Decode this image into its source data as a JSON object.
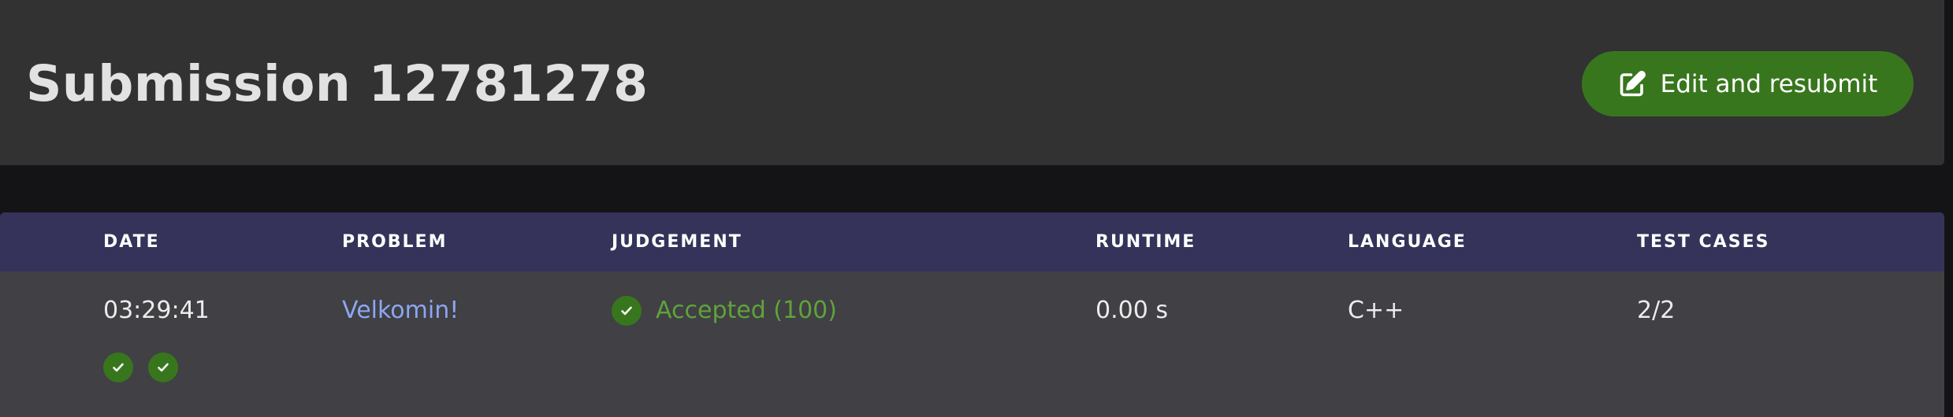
{
  "header": {
    "title": "Submission 12781278",
    "resubmit_label": "Edit and resubmit",
    "resubmit_icon": "edit-icon"
  },
  "table": {
    "columns": [
      "DATE",
      "PROBLEM",
      "JUDGEMENT",
      "RUNTIME",
      "LANGUAGE",
      "TEST CASES"
    ],
    "row": {
      "date": "03:29:41",
      "problem": "Velkomin!",
      "judgement": "Accepted (100)",
      "judgement_icon": "check-circle-icon",
      "runtime": "0.00 s",
      "language": "C++",
      "test_cases": "2/2"
    },
    "test_case_results": [
      "passed",
      "passed"
    ]
  },
  "colors": {
    "background": "#141416",
    "panel": "#323232",
    "table_head": "#353359",
    "table_body": "#404045",
    "accent_green": "#38761d",
    "accepted_text": "#5fa33a",
    "link": "#8da6f0"
  }
}
